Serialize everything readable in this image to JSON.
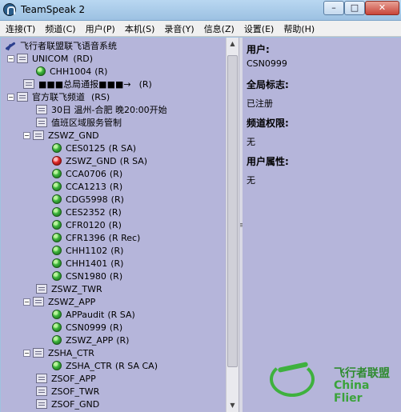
{
  "window": {
    "title": "TeamSpeak 2",
    "minimize": "–",
    "maximize": "□",
    "close": "✕"
  },
  "menu": [
    "连接(T)",
    "频道(C)",
    "用户(P)",
    "本机(S)",
    "录音(Y)",
    "信息(Z)",
    "设置(E)",
    "帮助(H)"
  ],
  "tree": {
    "root": "飞行者联盟联飞语音系统",
    "unicom": {
      "name": "UNICOM",
      "flags": "(RD)"
    },
    "chh1004": {
      "name": "CHH1004",
      "flags": "(R)"
    },
    "notice": {
      "name": "■■■总局通报■■■→",
      "flags": "(R)"
    },
    "official": {
      "name": "官方联飞频道",
      "flags": "(RS)"
    },
    "sub1": "30日 温州-合肥 晚20:00开始",
    "sub2": "值班区域服务管制",
    "zswz_gnd": "ZSWZ_GND",
    "gnd_users": [
      {
        "name": "CES0125",
        "flags": "(R SA)"
      },
      {
        "name": "ZSWZ_GND",
        "flags": "(R SA)"
      },
      {
        "name": "CCA0706",
        "flags": "(R)"
      },
      {
        "name": "CCA1213",
        "flags": "(R)"
      },
      {
        "name": "CDG5998",
        "flags": "(R)"
      },
      {
        "name": "CES2352",
        "flags": "(R)"
      },
      {
        "name": "CFR0120",
        "flags": "(R)"
      },
      {
        "name": "CFR1396",
        "flags": "(R Rec)"
      },
      {
        "name": "CHH1102",
        "flags": "(R)"
      },
      {
        "name": "CHH1401",
        "flags": "(R)"
      },
      {
        "name": "CSN1980",
        "flags": "(R)"
      }
    ],
    "zswz_twr": "ZSWZ_TWR",
    "zswz_app": "ZSWZ_APP",
    "app_users": [
      {
        "name": "APPaudit",
        "flags": "(R SA)"
      },
      {
        "name": "CSN0999",
        "flags": "(R)"
      },
      {
        "name": "ZSWZ_APP",
        "flags": "(R)"
      }
    ],
    "zsha_ctr": "ZSHA_CTR",
    "ctr_users": [
      {
        "name": "ZSHA_CTR",
        "flags": "(R SA CA)"
      }
    ],
    "zsof_app": "ZSOF_APP",
    "zsof_twr": "ZSOF_TWR",
    "zsof_gnd": "ZSOF_GND"
  },
  "info": {
    "user_label": "用户:",
    "user_value": "CSN0999",
    "global_label": "全局标志:",
    "global_value": "已注册",
    "channel_label": "频道权限:",
    "channel_value": "无",
    "attr_label": "用户属性:",
    "attr_value": "无"
  },
  "watermark": {
    "cn": "飞行者联盟",
    "en": "China Flier"
  },
  "colors": {
    "tree_bg": "#b5b5da",
    "active_user": "#3fb63f",
    "speaking_user": "#e22d2d"
  }
}
